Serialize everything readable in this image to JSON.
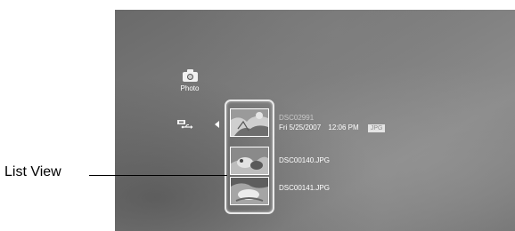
{
  "photo_category": {
    "label": "Photo",
    "icon": "camera-icon"
  },
  "device_icon": "usb-device-icon",
  "list": {
    "items": [
      {
        "filename": "DSC02991",
        "date": "Fri  5/25/2007",
        "time": "12:06 PM",
        "type_badge": "JPG",
        "icon": "photo-thumbnail"
      },
      {
        "filename": "DSC00140.JPG",
        "icon": "photo-thumbnail"
      },
      {
        "filename": "DSC00141.JPG",
        "icon": "photo-thumbnail"
      }
    ]
  },
  "callout": {
    "label": "List View"
  }
}
